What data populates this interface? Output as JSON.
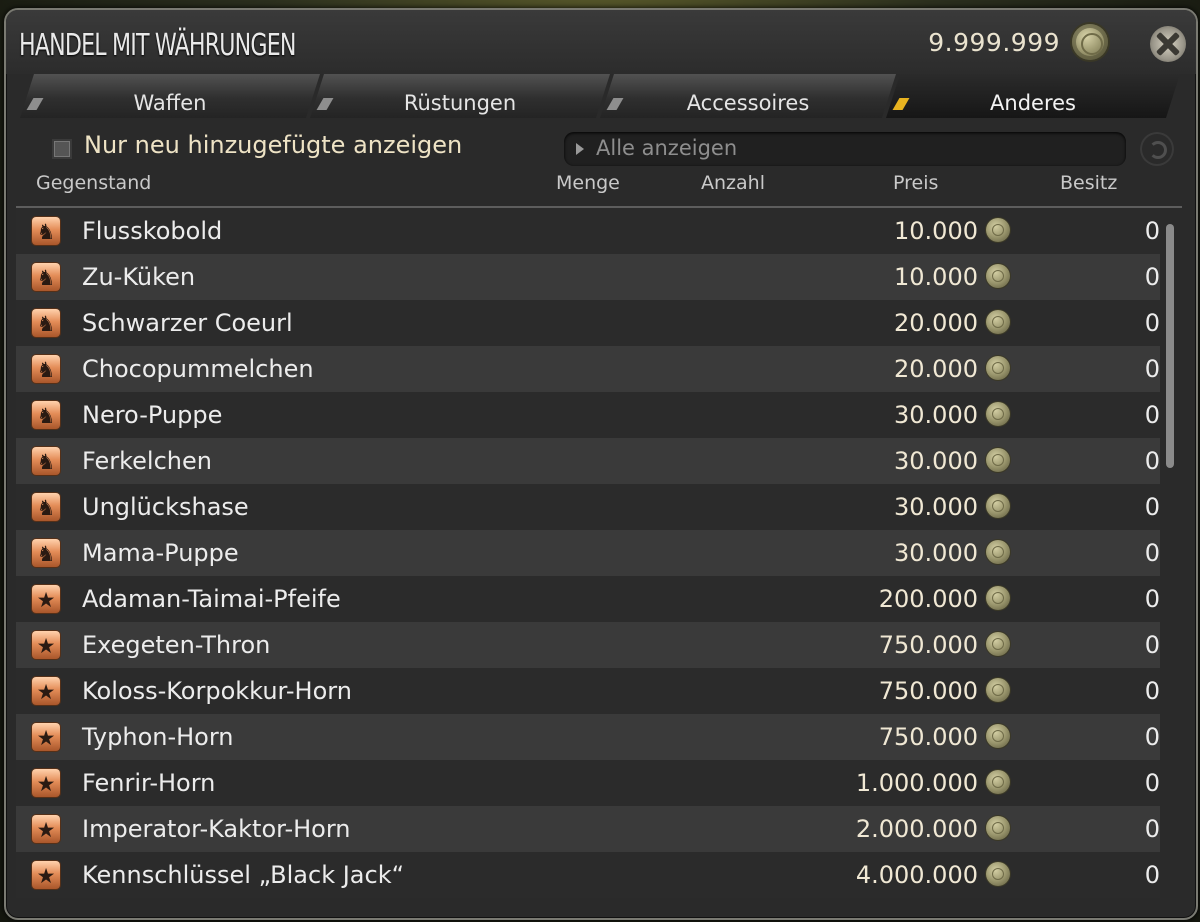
{
  "window": {
    "title": "HANDEL MIT WÄHRUNGEN",
    "currency_amount": "9.999.999",
    "currency_icon": "coin-icon",
    "close_icon": "close-icon"
  },
  "tabs": [
    {
      "label": "Waffen",
      "active": false
    },
    {
      "label": "Rüstungen",
      "active": false
    },
    {
      "label": "Accessoires",
      "active": false
    },
    {
      "label": "Anderes",
      "active": true
    }
  ],
  "filter": {
    "checkbox_label": "Nur neu hinzugefügte anzeigen",
    "checkbox_checked": false,
    "dropdown_value": "Alle anzeigen"
  },
  "columns": {
    "item": "Gegenstand",
    "quantity": "Menge",
    "count": "Anzahl",
    "price": "Preis",
    "owned": "Besitz"
  },
  "items": [
    {
      "name": "Flusskobold",
      "price": "10.000",
      "owned": "0",
      "icon": "minion-icon"
    },
    {
      "name": "Zu-Küken",
      "price": "10.000",
      "owned": "0",
      "icon": "minion-icon"
    },
    {
      "name": "Schwarzer Coeurl",
      "price": "20.000",
      "owned": "0",
      "icon": "minion-icon"
    },
    {
      "name": "Chocopummelchen",
      "price": "20.000",
      "owned": "0",
      "icon": "minion-icon"
    },
    {
      "name": "Nero-Puppe",
      "price": "30.000",
      "owned": "0",
      "icon": "minion-icon"
    },
    {
      "name": "Ferkelchen",
      "price": "30.000",
      "owned": "0",
      "icon": "minion-icon"
    },
    {
      "name": "Unglückshase",
      "price": "30.000",
      "owned": "0",
      "icon": "minion-icon"
    },
    {
      "name": "Mama-Puppe",
      "price": "30.000",
      "owned": "0",
      "icon": "minion-icon"
    },
    {
      "name": "Adaman-Taimai-Pfeife",
      "price": "200.000",
      "owned": "0",
      "icon": "star-icon"
    },
    {
      "name": "Exegeten-Thron",
      "price": "750.000",
      "owned": "0",
      "icon": "star-icon"
    },
    {
      "name": "Koloss-Korpokkur-Horn",
      "price": "750.000",
      "owned": "0",
      "icon": "star-icon"
    },
    {
      "name": "Typhon-Horn",
      "price": "750.000",
      "owned": "0",
      "icon": "star-icon"
    },
    {
      "name": "Fenrir-Horn",
      "price": "1.000.000",
      "owned": "0",
      "icon": "star-icon"
    },
    {
      "name": "Imperator-Kaktor-Horn",
      "price": "2.000.000",
      "owned": "0",
      "icon": "star-icon"
    },
    {
      "name": "Kennschlüssel „Black Jack“",
      "price": "4.000.000",
      "owned": "0",
      "icon": "star-icon"
    }
  ]
}
